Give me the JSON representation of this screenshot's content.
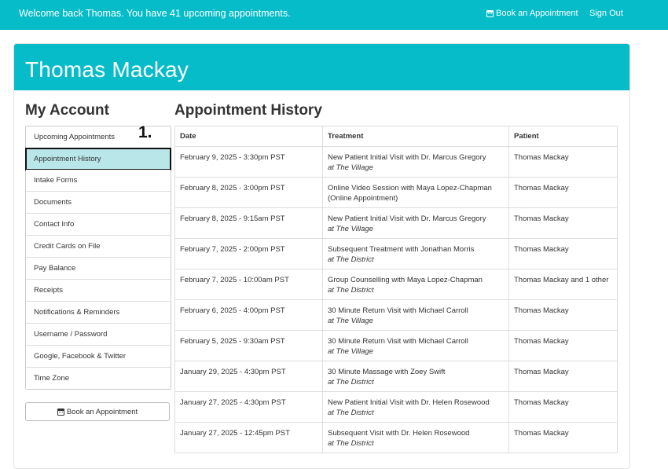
{
  "topbar": {
    "welcome": "Welcome back Thomas. You have 41 upcoming appointments.",
    "book_label": "Book an Appointment",
    "signout_label": "Sign Out"
  },
  "profile": {
    "name": "Thomas Mackay"
  },
  "sidebar": {
    "title": "My Account",
    "items": [
      {
        "label": "Upcoming Appointments"
      },
      {
        "label": "Appointment History"
      },
      {
        "label": "Intake Forms"
      },
      {
        "label": "Documents"
      },
      {
        "label": "Contact Info"
      },
      {
        "label": "Credit Cards on File"
      },
      {
        "label": "Pay Balance"
      },
      {
        "label": "Receipts"
      },
      {
        "label": "Notifications & Reminders"
      },
      {
        "label": "Username / Password"
      },
      {
        "label": "Google, Facebook & Twitter"
      },
      {
        "label": "Time Zone"
      }
    ],
    "book_label": "Book an Appointment",
    "step_marker": "1."
  },
  "main": {
    "title": "Appointment History",
    "columns": [
      "Date",
      "Treatment",
      "Patient"
    ],
    "rows": [
      {
        "date": "February 9, 2025 - 3:30pm PST",
        "treatment": "New Patient Initial Visit with Dr. Marcus Gregory",
        "location": "at The Village",
        "patient": "Thomas Mackay"
      },
      {
        "date": "February 8, 2025 - 3:00pm PST",
        "treatment": "Online Video Session with Maya Lopez-Chapman",
        "location": "(Online Appointment)",
        "patient": "Thomas Mackay"
      },
      {
        "date": "February 8, 2025 - 9:15am PST",
        "treatment": "New Patient Initial Visit with Dr. Marcus Gregory",
        "location": "at The Village",
        "patient": "Thomas Mackay"
      },
      {
        "date": "February 7, 2025 - 2:00pm PST",
        "treatment": "Subsequent Treatment with Jonathan Morris",
        "location": "at The District",
        "patient": "Thomas Mackay"
      },
      {
        "date": "February 7, 2025 - 10:00am PST",
        "treatment": "Group Counselling with Maya Lopez-Chapman",
        "location": "at The District",
        "patient": "Thomas Mackay and 1 other"
      },
      {
        "date": "February 6, 2025 - 4:00pm PST",
        "treatment": "30 Minute Return Visit with Michael Carroll",
        "location": "at The Village",
        "patient": "Thomas Mackay"
      },
      {
        "date": "February 5, 2025 - 9:30am PST",
        "treatment": "30 Minute Return Visit with Michael Carroll",
        "location": "at The Village",
        "patient": "Thomas Mackay"
      },
      {
        "date": "January 29, 2025 - 4:30pm PST",
        "treatment": "30 Minute Massage with Zoey Swift",
        "location": "at The District",
        "patient": "Thomas Mackay"
      },
      {
        "date": "January 27, 2025 - 4:30pm PST",
        "treatment": "New Patient Initial Visit with Dr. Helen Rosewood",
        "location": "at The District",
        "patient": "Thomas Mackay"
      },
      {
        "date": "January 27, 2025 - 12:45pm PST",
        "treatment": "Subsequent Visit with Dr. Helen Rosewood",
        "location": "at The District",
        "patient": "Thomas Mackay"
      }
    ]
  }
}
